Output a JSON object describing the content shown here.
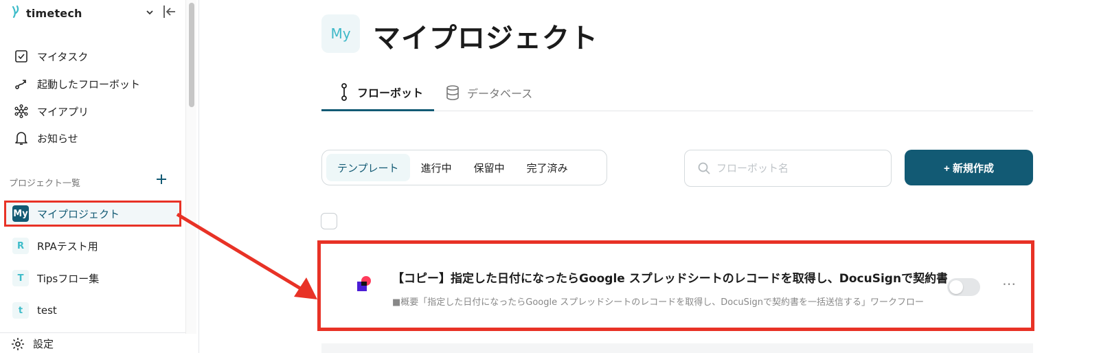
{
  "sidebar": {
    "brand": "timetech",
    "nav": [
      {
        "label": "マイタスク",
        "icon": "checkbox-icon"
      },
      {
        "label": "起動したフローボット",
        "icon": "flow-line-icon"
      },
      {
        "label": "マイアプリ",
        "icon": "network-icon"
      },
      {
        "label": "お知らせ",
        "icon": "bell-icon"
      }
    ],
    "section_label": "プロジェクト一覧",
    "projects": [
      {
        "badge": "My",
        "label": "マイプロジェクト",
        "active": true
      },
      {
        "badge": "R",
        "label": "RPAテスト用"
      },
      {
        "badge": "T",
        "label": "Tipsフロー集"
      },
      {
        "badge": "t",
        "label": "test"
      }
    ],
    "settings_label": "設定"
  },
  "main": {
    "avatar": "My",
    "title": "マイプロジェクト",
    "tabs": [
      {
        "label": "フローボット",
        "active": true
      },
      {
        "label": "データベース"
      }
    ],
    "filters": [
      {
        "label": "テンプレート",
        "active": true
      },
      {
        "label": "進行中"
      },
      {
        "label": "保留中"
      },
      {
        "label": "完了済み"
      }
    ],
    "search": {
      "placeholder": "フローボット名",
      "value": ""
    },
    "new_button": "+ 新規作成",
    "flow": {
      "title": "【コピー】指定した日付になったらGoogle スプレッドシートのレコードを取得し、DocuSignで契約書",
      "description": "■概要「指定した日付になったらGoogle スプレッドシートのレコードを取得し、DocuSignで契約書を一括送信する」ワークフロー",
      "enabled": false,
      "more": "⋯"
    }
  },
  "colors": {
    "accent": "#125a74",
    "highlight": "#e83226",
    "badge_text": "#3dbcc9"
  }
}
